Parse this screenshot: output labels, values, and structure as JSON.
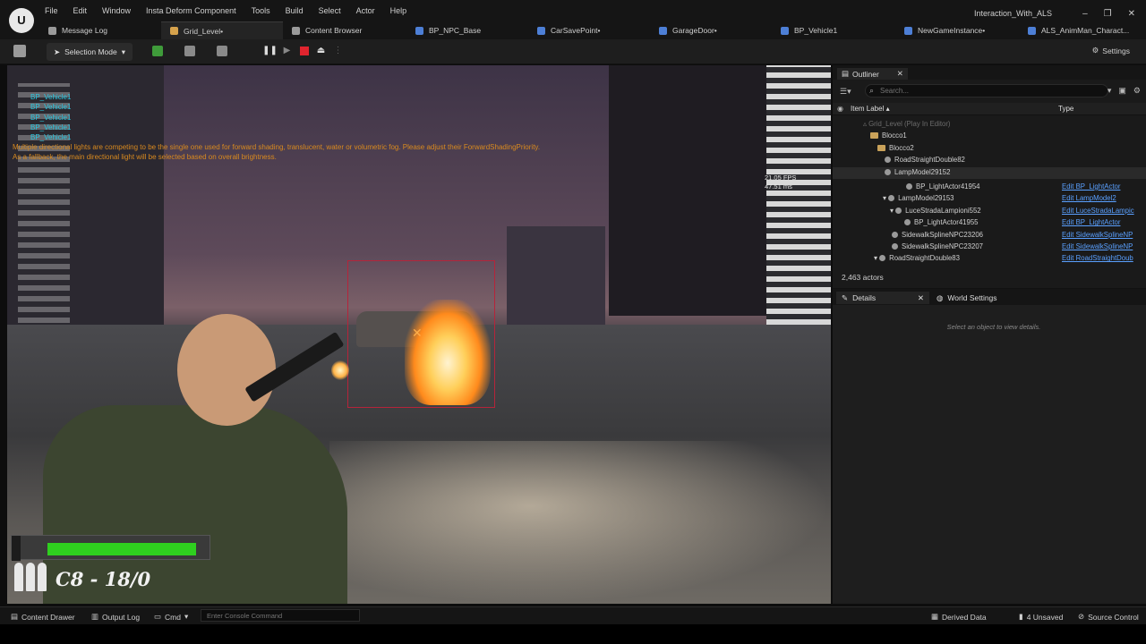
{
  "menu": [
    "File",
    "Edit",
    "Window",
    "Insta Deform Component",
    "Tools",
    "Build",
    "Select",
    "Actor",
    "Help"
  ],
  "project_name": "Interaction_With_ALS",
  "tabs": [
    {
      "label": "Message Log",
      "color": "#bbbbbb"
    },
    {
      "label": "Grid_Level•",
      "color": "#d6a24c"
    },
    {
      "label": "Content Browser",
      "color": "#bbbbbb"
    },
    {
      "label": "BP_NPC_Base",
      "color": "#4d7fd6"
    },
    {
      "label": "CarSavePoint•",
      "color": "#4d7fd6"
    },
    {
      "label": "GarageDoor•",
      "color": "#4d7fd6"
    },
    {
      "label": "BP_Vehicle1",
      "color": "#4d7fd6"
    },
    {
      "label": "NewGameInstance•",
      "color": "#4d7fd6"
    },
    {
      "label": "ALS_AnimMan_Charact...",
      "color": "#4d7fd6"
    }
  ],
  "toolbar": {
    "selection_mode": "Selection Mode",
    "settings": "Settings"
  },
  "viewport": {
    "debug_lines": [
      "BP_Vehicle1",
      "BP_Vehicle1",
      "BP_Vehicle1",
      "BP_Vehicle1",
      "BP_Vehicle1"
    ],
    "warning_line1": "Multiple directional lights are competing to be the single one used for forward shading, translucent, water or volumetric fog. Please adjust their ForwardShadingPriority.",
    "warning_line2": "As a fallback, the main directional light will be selected based on overall brightness.",
    "fps": "21.05 FPS",
    "ms": "47.51 ms"
  },
  "hud": {
    "health_fraction": 0.93,
    "ammo_text": "C8 - 18/0",
    "bullet_icons": 3
  },
  "outliner": {
    "title": "Outliner",
    "search_placeholder": "Search...",
    "col_label": "Item Label",
    "col_type": "Type",
    "rows": [
      {
        "name": "Grid_Level (Play In Editor)",
        "icon": "level",
        "link": ""
      },
      {
        "name": "Blocco1",
        "icon": "folder",
        "link": ""
      },
      {
        "name": "Blocco2",
        "icon": "folder",
        "link": ""
      },
      {
        "name": "RoadStraightDouble82",
        "icon": "actor",
        "link": ""
      },
      {
        "name": "LampModel29152",
        "icon": "actor",
        "link": ""
      },
      {
        "name": "BP_LightActor41954",
        "icon": "actor",
        "link": "Edit BP_LightActor"
      },
      {
        "name": "LampModel29153",
        "icon": "actor",
        "link": "Edit LampModel2"
      },
      {
        "name": "LuceStradaLampioni552",
        "icon": "actor",
        "link": "Edit LuceStradaLampic"
      },
      {
        "name": "BP_LightActor41955",
        "icon": "actor",
        "link": "Edit BP_LightActor"
      },
      {
        "name": "SidewalkSplineNPC23206",
        "icon": "actor",
        "link": "Edit SidewalkSplineNP"
      },
      {
        "name": "SidewalkSplineNPC23207",
        "icon": "actor",
        "link": "Edit SidewalkSplineNP"
      },
      {
        "name": "RoadStraightDouble83",
        "icon": "actor",
        "link": "Edit RoadStraightDoub"
      }
    ],
    "actor_count": "2,463 actors"
  },
  "details": {
    "tab_details": "Details",
    "tab_world": "World Settings",
    "empty_text": "Select an object to view details."
  },
  "statusbar": {
    "content_drawer": "Content Drawer",
    "output_log": "Output Log",
    "cmd": "Cmd",
    "console_placeholder": "Enter Console Command",
    "derived_data": "Derived Data",
    "unsaved": "4 Unsaved",
    "source_control": "Source Control"
  }
}
